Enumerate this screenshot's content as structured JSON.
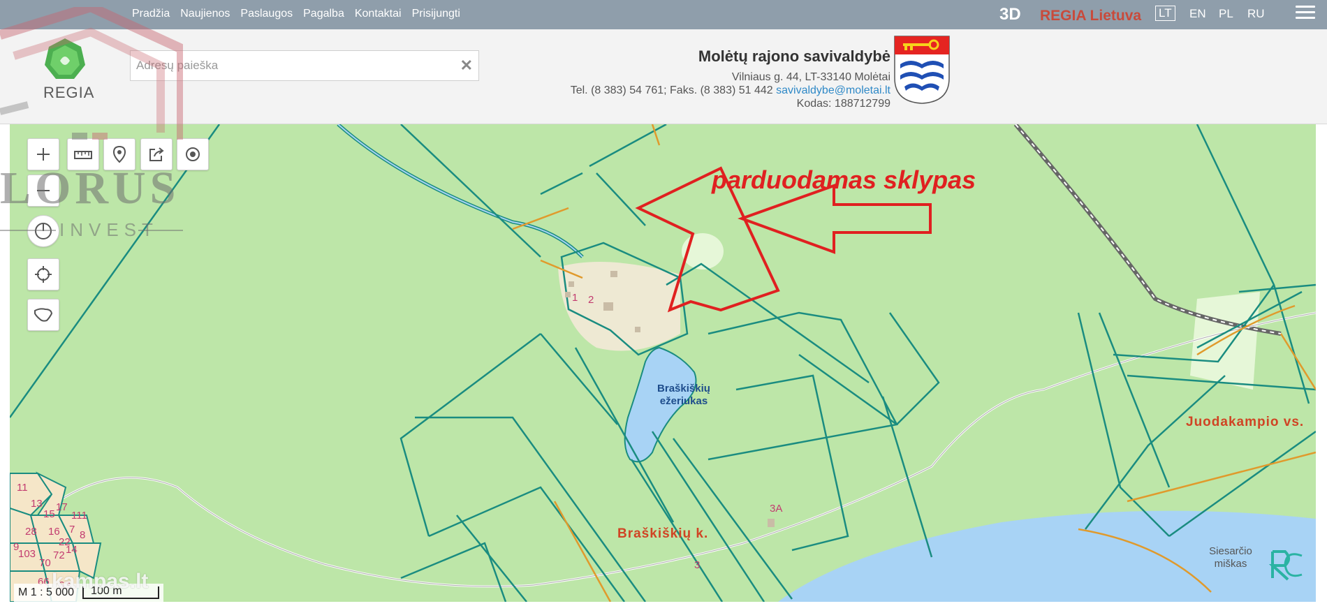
{
  "nav": {
    "items": [
      "Pradžia",
      "Naujienos",
      "Paslaugos",
      "Pagalba",
      "Kontaktai",
      "Prisijungti"
    ],
    "mode_3d": "3D",
    "brand": "REGIA Lietuva",
    "languages": [
      "LT",
      "EN",
      "PL",
      "RU"
    ],
    "active_language": "LT",
    "menu_icon": "hamburger-icon"
  },
  "header": {
    "logo_text": "REGIA",
    "search_placeholder": "Adresų paieška",
    "search_value": "",
    "clear_icon": "close-icon",
    "municipality": {
      "name": "Molėtų rajono savivaldybė",
      "address": "Vilniaus g. 44, LT-33140 Molėtai",
      "tel_fax": "Tel. (8 383) 54 761; Faks. (8 383) 51 442",
      "email": "savivaldybe@moletai.lt",
      "code": "Kodas: 188712799"
    },
    "crest_icon": "municipality-crest-icon"
  },
  "map": {
    "annotation": "parduodamas sklypas",
    "labels": {
      "lake": [
        "Braškiškių",
        "ežeriukas"
      ],
      "village": "Braškiškių k.",
      "juodakampio": "Juodakampio vs.",
      "forest": [
        "Siesarčio",
        "miškas"
      ],
      "lot_1": "1",
      "lot_2": "2",
      "lot_3a": "3A",
      "lot_3": "3",
      "left_numbers": [
        "11",
        "13",
        "15",
        "17",
        "111",
        "28",
        "16",
        "7",
        "8",
        "22",
        "9",
        "103",
        "70",
        "72",
        "14",
        "66",
        "68"
      ]
    },
    "scale_ratio": "M 1 : 5 000",
    "scale_bar": "100 m",
    "colors": {
      "land": "#bde6a8",
      "water": "#a8d3f5",
      "parcel_line": "#1a8c80",
      "orange_line": "#e09a2c",
      "highlight": "#e02020"
    }
  },
  "controls": [
    {
      "name": "zoom-in",
      "icon": "plus-icon"
    },
    {
      "name": "measure",
      "icon": "ruler-icon"
    },
    {
      "name": "marker",
      "icon": "pin-icon"
    },
    {
      "name": "share",
      "icon": "share-icon"
    },
    {
      "name": "locate",
      "icon": "target-icon"
    },
    {
      "name": "zoom-out",
      "icon": "minus-icon"
    },
    {
      "name": "rotate",
      "icon": "compass-icon"
    },
    {
      "name": "gps",
      "icon": "crosshair-icon"
    },
    {
      "name": "lithuania",
      "icon": "lithuania-outline-icon"
    }
  ],
  "watermarks": {
    "lorus": "LORUS",
    "invest": "INVEST",
    "kampas": "kampas.lt"
  }
}
